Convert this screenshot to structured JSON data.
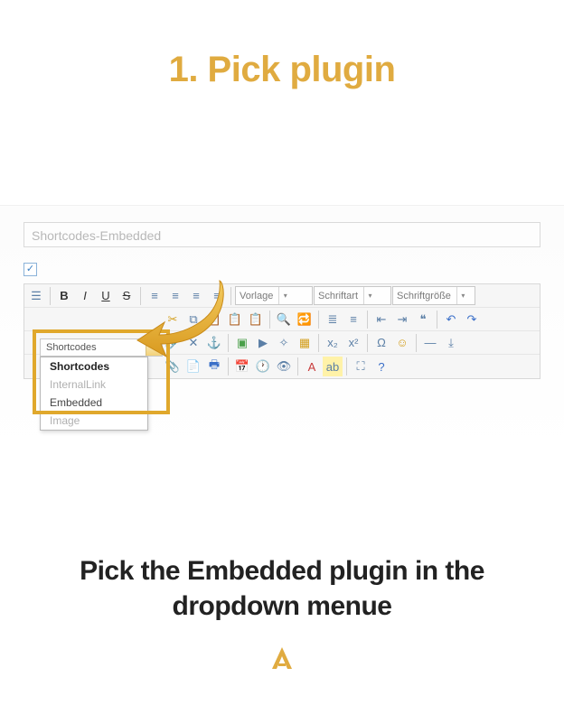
{
  "title": "1. Pick plugin",
  "title_field": "Shortcodes-Embedded",
  "checkbox_checked": "✓",
  "row1": {
    "vorlage": "Vorlage",
    "schriftart": "Schriftart",
    "schriftgroesse": "Schriftgröße"
  },
  "shortcodes": {
    "label": "Shortcodes",
    "items": {
      "header": "Shortcodes",
      "internal": "InternalLink",
      "embedded": "Embedded",
      "image": "Image"
    }
  },
  "icons": {
    "bold": "B",
    "italic": "I",
    "underline": "U",
    "strike": "S",
    "cut": "✂",
    "copy": "⧉",
    "paste": "📋",
    "undo": "↶",
    "redo": "↷",
    "list_ul": "≣",
    "list_ol": "≡",
    "outdent": "⇤",
    "indent": "⇥",
    "quote": "❝",
    "align_l": "≡",
    "align_c": "≡",
    "align_r": "≡",
    "align_j": "≡",
    "link": "🔗",
    "unlink": "✕",
    "anchor": "⚓",
    "image": "▣",
    "table": "▦",
    "hr": "—",
    "sub": "x₂",
    "sup": "x²",
    "omega": "Ω",
    "smile": "☺",
    "date": "📅",
    "media": "▶",
    "clean": "✧",
    "font_color": "A",
    "highlight": "ab",
    "help": "?",
    "doc": "☰"
  },
  "caption": "Pick the Embedded plugin in the dropdown menue"
}
